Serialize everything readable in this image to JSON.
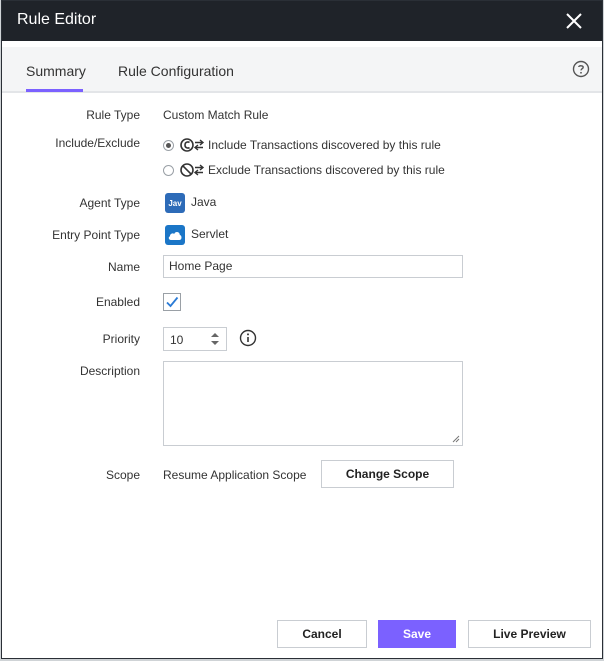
{
  "dialog": {
    "title": "Rule Editor",
    "close_icon": "close-icon",
    "help_icon": "help-circle-icon"
  },
  "tabs": [
    {
      "label": "Summary",
      "active": true
    },
    {
      "label": "Rule Configuration",
      "active": false
    }
  ],
  "form": {
    "rule_type": {
      "label": "Rule Type",
      "value": "Custom Match Rule"
    },
    "include_exclude": {
      "label": "Include/Exclude",
      "options": [
        {
          "text": "Include Transactions discovered by this rule",
          "selected": true,
          "icon": "include-transaction-icon"
        },
        {
          "text": "Exclude Transactions discovered by this rule",
          "selected": false,
          "icon": "exclude-transaction-icon"
        }
      ]
    },
    "agent_type": {
      "label": "Agent Type",
      "value": "Java",
      "badge": "Jav",
      "icon": "java-icon"
    },
    "entry_point_type": {
      "label": "Entry Point Type",
      "value": "Servlet",
      "icon": "cloud-icon"
    },
    "name": {
      "label": "Name",
      "value": "Home Page"
    },
    "enabled": {
      "label": "Enabled",
      "checked": true
    },
    "priority": {
      "label": "Priority",
      "value": "10",
      "info_icon": "info-icon"
    },
    "description": {
      "label": "Description",
      "value": ""
    },
    "scope": {
      "label": "Scope",
      "value": "Resume Application Scope",
      "change_button": "Change Scope"
    }
  },
  "footer": {
    "cancel": "Cancel",
    "save": "Save",
    "live_preview": "Live Preview"
  },
  "colors": {
    "accent": "#7b61ff",
    "titlebar": "#1f2329",
    "java_badge": "#2d6bb8",
    "cloud_badge": "#1b76c7"
  }
}
